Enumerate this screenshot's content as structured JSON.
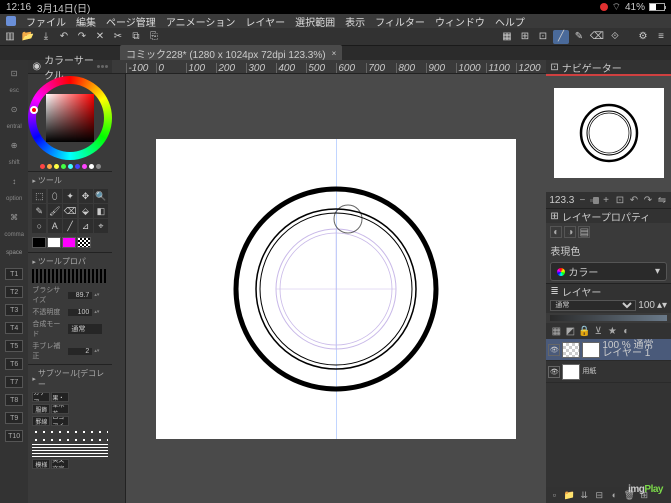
{
  "status": {
    "time": "12:16",
    "date": "3月14日(日)",
    "battery": "41%"
  },
  "menu": [
    "ファイル",
    "編集",
    "ページ管理",
    "アニメーション",
    "レイヤー",
    "選択範囲",
    "表示",
    "フィルター",
    "ウィンドウ",
    "ヘルプ"
  ],
  "tab": {
    "title": "コミック228* (1280 x 1024px 72dpi 123.3%)"
  },
  "panels": {
    "color": "カラーサークル",
    "tool": "ツール",
    "toolprop": "ツールプロパ",
    "brushsize_lbl": "ブラシサイズ",
    "brushsize": "89.7",
    "opacity_lbl": "不透明度",
    "opacity": "100",
    "anti_lbl": "合成モード",
    "anti_val": "通常",
    "stabilize_lbl": "手ブレ補正",
    "stabilize": "2",
    "subtool": "サブツール[デコレー",
    "subtabs": [
      "カケア",
      "効果・演",
      "服飾",
      "草木花",
      "罫線",
      "ロゴアイ",
      "模様",
      "英文文字"
    ]
  },
  "navigator": {
    "title": "ナビゲーター",
    "zoom": "123.3"
  },
  "layerprop": {
    "title": "レイヤープロパティ",
    "expr": "表現色",
    "color": "カラー"
  },
  "layers": {
    "title": "レイヤー",
    "blend": "通常",
    "opacity": "100",
    "row1": {
      "op": "100 % 通常",
      "name": "レイヤー 1"
    },
    "row2": {
      "name": "用紙"
    }
  },
  "leftbadges": [
    "T1",
    "T2",
    "T3",
    "T4",
    "T5",
    "T6",
    "T7",
    "T8",
    "T9",
    "T10"
  ],
  "leftlabels": [
    "esc",
    "entral",
    "shift",
    "option",
    "comma"
  ],
  "watermark": {
    "a": "img",
    "b": "Play"
  }
}
